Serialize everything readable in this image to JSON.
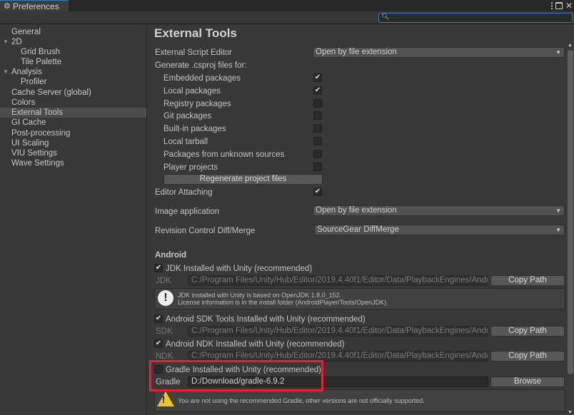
{
  "window": {
    "tab_title": "Preferences",
    "tab_icon": "gear-icon",
    "controls": {
      "menu": "⋮",
      "close": "✕"
    }
  },
  "search": {
    "placeholder": "",
    "value": ""
  },
  "sidebar": {
    "items": [
      {
        "label": "General",
        "level": 0
      },
      {
        "label": "2D",
        "level": 0,
        "expanded": true
      },
      {
        "label": "Grid Brush",
        "level": 1
      },
      {
        "label": "Tile Palette",
        "level": 1
      },
      {
        "label": "Analysis",
        "level": 0,
        "expanded": true
      },
      {
        "label": "Profiler",
        "level": 1
      },
      {
        "label": "Cache Server (global)",
        "level": 0
      },
      {
        "label": "Colors",
        "level": 0
      },
      {
        "label": "External Tools",
        "level": 0,
        "selected": true
      },
      {
        "label": "GI Cache",
        "level": 0
      },
      {
        "label": "Post-processing",
        "level": 0
      },
      {
        "label": "UI Scaling",
        "level": 0
      },
      {
        "label": "VIU Settings",
        "level": 0
      },
      {
        "label": "Wave Settings",
        "level": 0
      }
    ]
  },
  "main": {
    "title": "External Tools",
    "external_script_editor": {
      "label": "External Script Editor",
      "value": "Open by file extension"
    },
    "generate_label": "Generate .csproj files for:",
    "csproj_options": [
      {
        "label": "Embedded packages",
        "checked": true
      },
      {
        "label": "Local packages",
        "checked": true
      },
      {
        "label": "Registry packages",
        "checked": false
      },
      {
        "label": "Git packages",
        "checked": false
      },
      {
        "label": "Built-in packages",
        "checked": false
      },
      {
        "label": "Local tarball",
        "checked": false
      },
      {
        "label": "Packages from unknown sources",
        "checked": false
      },
      {
        "label": "Player projects",
        "checked": false
      }
    ],
    "regenerate_button": "Regenerate project files",
    "editor_attaching": {
      "label": "Editor Attaching",
      "checked": true
    },
    "image_application": {
      "label": "Image application",
      "value": "Open by file extension"
    },
    "revision_control": {
      "label": "Revision Control Diff/Merge",
      "value": "SourceGear DiffMerge"
    },
    "android": {
      "section_label": "Android",
      "jdk": {
        "toggle_label": "JDK Installed with Unity (recommended)",
        "checked": true,
        "field_label": "JDK",
        "path": "C:/Program Files/Unity/Hub/Editor/2019.4.40f1/Editor/Data/PlaybackEngines/Andro",
        "button": "Copy Path",
        "info_line1": "JDK installed with Unity is based on OpenJDK 1.8.0_152.",
        "info_line2": "License information is in the install folder (AndroidPlayer/Tools/OpenJDK)."
      },
      "sdk": {
        "toggle_label": "Android SDK Tools Installed with Unity (recommended)",
        "checked": true,
        "field_label": "SDK",
        "path": "C:/Program Files/Unity/Hub/Editor/2019.4.40f1/Editor/Data/PlaybackEngines/Andro",
        "button": "Copy Path"
      },
      "ndk": {
        "toggle_label": "Android NDK Installed with Unity (recommended)",
        "checked": true,
        "field_label": "NDK",
        "path": "C:/Program Files/Unity/Hub/Editor/2019.4.40f1/Editor/Data/PlaybackEngines/Andro",
        "button": "Copy Path"
      },
      "gradle": {
        "toggle_label": "Gradle Installed with Unity (recommended)",
        "checked": false,
        "field_label": "Gradle",
        "path": "D:/Download/gradle-6.9.2",
        "button": "Browse",
        "warning": "You are not using the recommended Gradle, other versions are not officially supported."
      }
    }
  },
  "colors": {
    "accent": "#3a79bb",
    "highlight": "#e8212a",
    "warning": "#f2c028"
  }
}
